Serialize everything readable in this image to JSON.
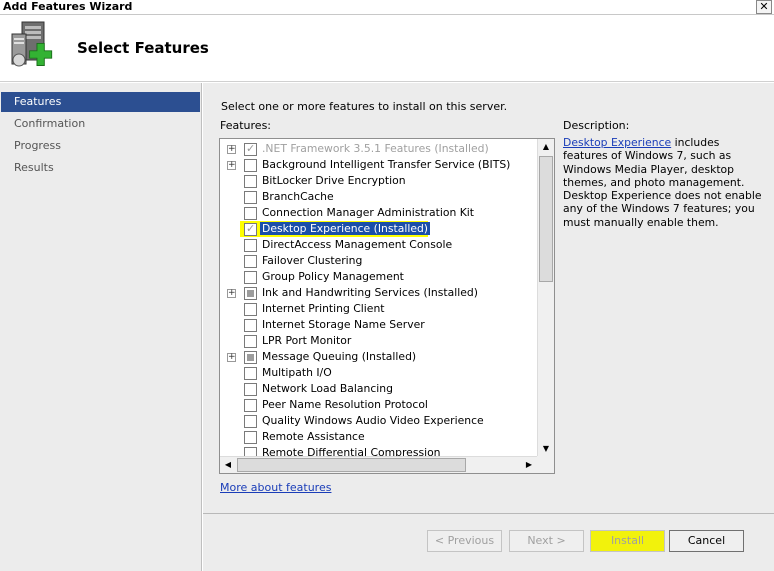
{
  "window": {
    "title": "Add Features Wizard",
    "close_glyph": "✕"
  },
  "header": {
    "heading": "Select Features",
    "icon": "server-add-icon"
  },
  "nav": {
    "items": [
      {
        "label": "Features",
        "active": true
      },
      {
        "label": "Confirmation"
      },
      {
        "label": "Progress"
      },
      {
        "label": "Results"
      }
    ]
  },
  "main": {
    "instruction": "Select one or more features to install on this server.",
    "features_label": "Features:",
    "description_label": "Description:",
    "description": {
      "link": "Desktop Experience",
      "text": " includes features of Windows 7, such as Windows Media Player, desktop themes, and photo management. Desktop Experience does not enable any of the Windows 7 features; you must manually enable them."
    },
    "features": [
      {
        "label": ".NET Framework 3.5.1 Features  (Installed)",
        "expandable": true,
        "state": "checked",
        "disabled": true
      },
      {
        "label": "Background Intelligent Transfer Service (BITS)",
        "expandable": true,
        "state": "unchecked"
      },
      {
        "label": "BitLocker Drive Encryption",
        "state": "unchecked"
      },
      {
        "label": "BranchCache",
        "state": "unchecked"
      },
      {
        "label": "Connection Manager Administration Kit",
        "state": "unchecked"
      },
      {
        "label": "Desktop Experience  (Installed)",
        "state": "checked",
        "selected": true
      },
      {
        "label": "DirectAccess Management Console",
        "state": "unchecked"
      },
      {
        "label": "Failover Clustering",
        "state": "unchecked"
      },
      {
        "label": "Group Policy Management",
        "state": "unchecked"
      },
      {
        "label": "Ink and Handwriting Services  (Installed)",
        "expandable": true,
        "state": "partial"
      },
      {
        "label": "Internet Printing Client",
        "state": "unchecked"
      },
      {
        "label": "Internet Storage Name Server",
        "state": "unchecked"
      },
      {
        "label": "LPR Port Monitor",
        "state": "unchecked"
      },
      {
        "label": "Message Queuing  (Installed)",
        "expandable": true,
        "state": "partial"
      },
      {
        "label": "Multipath I/O",
        "state": "unchecked"
      },
      {
        "label": "Network Load Balancing",
        "state": "unchecked"
      },
      {
        "label": "Peer Name Resolution Protocol",
        "state": "unchecked"
      },
      {
        "label": "Quality Windows Audio Video Experience",
        "state": "unchecked"
      },
      {
        "label": "Remote Assistance",
        "state": "unchecked"
      },
      {
        "label": "Remote Differential Compression",
        "state": "unchecked"
      }
    ],
    "more_link": "More about features"
  },
  "buttons": {
    "previous": "< Previous",
    "next": "Next >",
    "install": "Install",
    "cancel": "Cancel"
  },
  "colors": {
    "nav_active": "#2c4f91",
    "highlight": "#ffff00",
    "selection": "#1b4fa8"
  }
}
